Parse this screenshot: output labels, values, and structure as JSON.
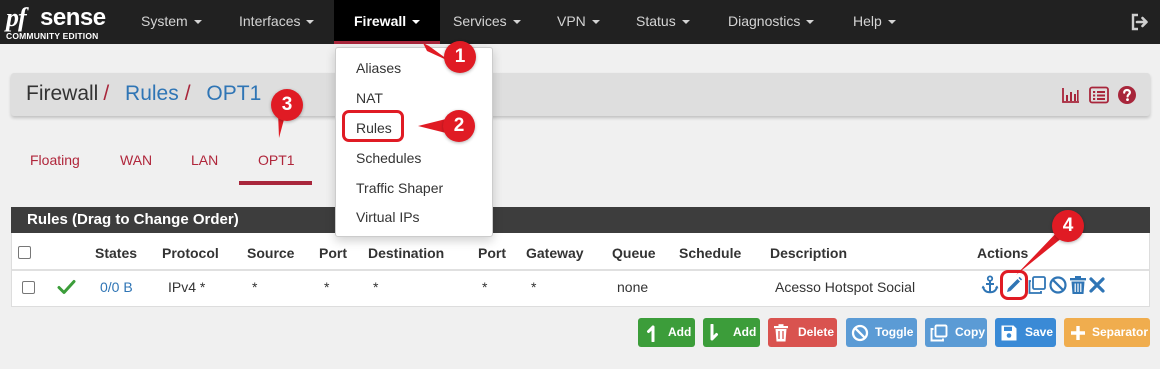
{
  "brand": {
    "logo_pf": "pf",
    "logo_sense": "sense",
    "edition": "COMMUNITY EDITION"
  },
  "nav": {
    "items": [
      {
        "label": "System"
      },
      {
        "label": "Interfaces"
      },
      {
        "label": "Firewall"
      },
      {
        "label": "Services"
      },
      {
        "label": "VPN"
      },
      {
        "label": "Status"
      },
      {
        "label": "Diagnostics"
      },
      {
        "label": "Help"
      }
    ],
    "active": "Firewall"
  },
  "firewall_menu": {
    "items": [
      {
        "label": "Aliases"
      },
      {
        "label": "NAT"
      },
      {
        "label": "Rules"
      },
      {
        "label": "Schedules"
      },
      {
        "label": "Traffic Shaper"
      },
      {
        "label": "Virtual IPs"
      }
    ]
  },
  "callouts": [
    "1",
    "2",
    "3",
    "4"
  ],
  "breadcrumb": {
    "root": "Firewall",
    "sep": "/",
    "section": "Rules",
    "current": "OPT1"
  },
  "tabs": [
    {
      "label": "Floating"
    },
    {
      "label": "WAN"
    },
    {
      "label": "LAN"
    },
    {
      "label": "OPT1"
    }
  ],
  "active_tab": "OPT1",
  "rules_panel": {
    "title": "Rules (Drag to Change Order)",
    "columns": [
      "States",
      "Protocol",
      "Source",
      "Port",
      "Destination",
      "Port",
      "Gateway",
      "Queue",
      "Schedule",
      "Description",
      "Actions"
    ],
    "rows": [
      {
        "enabled": true,
        "states": "0/0 B",
        "protocol": "IPv4 *",
        "source": "*",
        "source_port": "*",
        "destination": "*",
        "destination_port": "*",
        "gateway": "*",
        "queue": "none",
        "schedule": "",
        "description": "Acesso Hotspot Social"
      }
    ]
  },
  "buttons": {
    "add_top": "Add",
    "add_bottom": "Add",
    "delete": "Delete",
    "toggle": "Toggle",
    "copy": "Copy",
    "save": "Save",
    "separator": "Separator"
  },
  "colors": {
    "navbar": "#212121",
    "accent": "#a8263b",
    "link": "#2f75b5",
    "callout": "#e01b24",
    "success": "#3c9d3a",
    "danger": "#d9534f",
    "info": "#5b9bd5",
    "primary": "#3a8ad6",
    "warning": "#f0ad4e"
  }
}
